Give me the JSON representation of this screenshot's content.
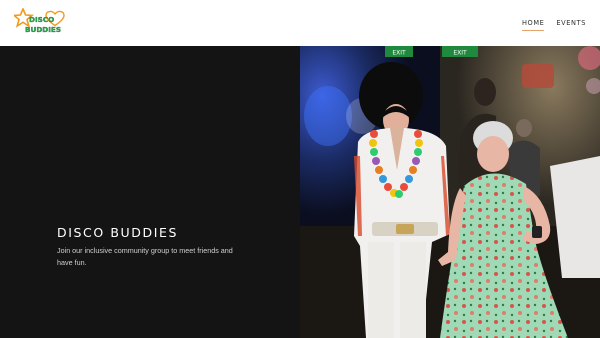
{
  "brand": {
    "logo_line1": "DISCO",
    "logo_line2": "BUDDIES"
  },
  "nav": {
    "items": [
      {
        "label": "HOME",
        "active": true
      },
      {
        "label": "EVENTS",
        "active": false
      }
    ]
  },
  "hero": {
    "title": "DISCO BUDDIES",
    "description": "Join our inclusive community group to meet friends and have fun.",
    "background_color": "#141414"
  },
  "photo": {
    "signs": [
      "EXIT",
      "EXIT"
    ]
  },
  "colors": {
    "logo_orange": "#f39a1e",
    "logo_green": "#27b24a",
    "nav_active_underline": "#e6a36a"
  }
}
